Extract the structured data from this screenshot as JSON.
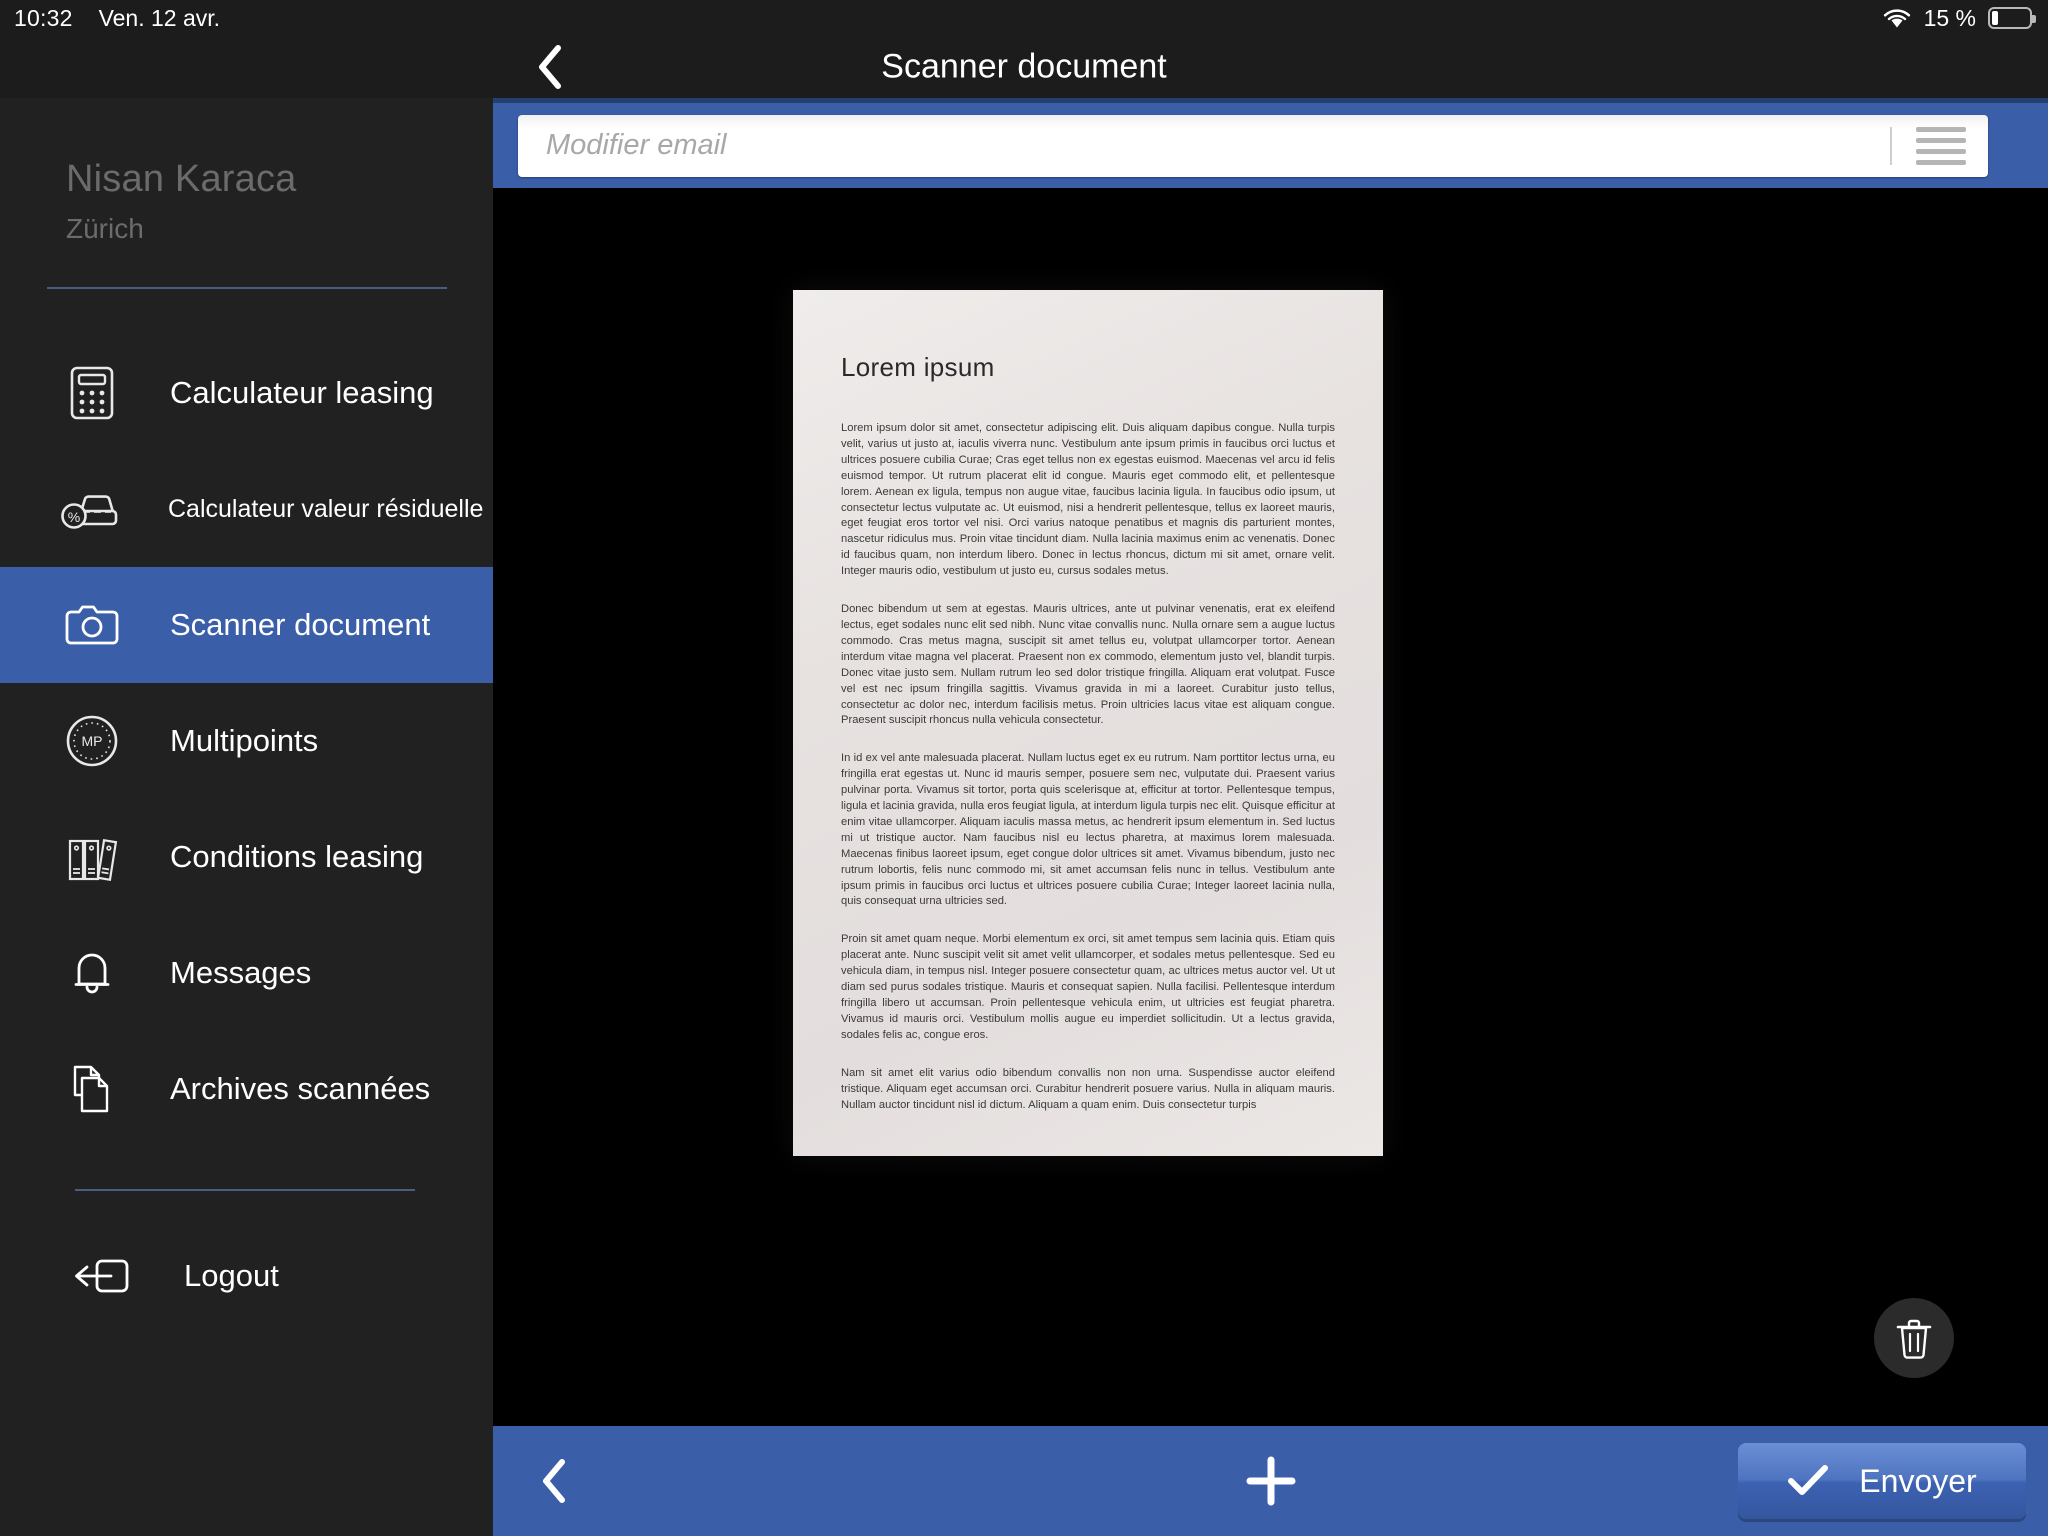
{
  "statusbar": {
    "time": "10:32",
    "date": "Ven. 12 avr.",
    "battery_percent": "15 %",
    "battery_level": 15,
    "wifi_icon": "wifi-icon",
    "battery_icon": "battery-icon"
  },
  "titlebar": {
    "back_icon": "chevron-left-icon",
    "title": "Scanner document"
  },
  "sidebar": {
    "user": {
      "name": "Nisan Karaca",
      "city": "Zürich"
    },
    "items": [
      {
        "label": "Calculateur leasing",
        "icon": "calculator-icon",
        "active": false,
        "small": false
      },
      {
        "label": "Calculateur valeur résiduelle",
        "icon": "car-percent-icon",
        "active": false,
        "small": true
      },
      {
        "label": "Scanner document",
        "icon": "camera-icon",
        "active": true,
        "small": false
      },
      {
        "label": "Multipoints",
        "icon": "multipoints-badge-icon",
        "active": false,
        "small": false
      },
      {
        "label": "Conditions leasing",
        "icon": "binders-icon",
        "active": false,
        "small": false
      },
      {
        "label": "Messages",
        "icon": "bell-icon",
        "active": false,
        "small": false
      },
      {
        "label": "Archives scannées",
        "icon": "documents-icon",
        "active": false,
        "small": false
      }
    ],
    "logout": {
      "label": "Logout",
      "icon": "logout-arrow-icon"
    }
  },
  "search": {
    "placeholder": "Modifier email",
    "value": "",
    "menu_icon": "hamburger-menu-icon"
  },
  "document": {
    "title": "Lorem ipsum",
    "paragraphs": [
      "Lorem ipsum dolor sit amet, consectetur adipiscing elit. Duis aliquam dapibus congue. Nulla turpis velit, varius ut justo at, iaculis viverra nunc. Vestibulum ante ipsum primis in faucibus orci luctus et ultrices posuere cubilia Curae; Cras eget tellus non ex egestas euismod. Maecenas vel arcu id felis euismod tempor. Ut rutrum placerat elit id congue. Mauris eget commodo elit, et pellentesque lorem. Aenean ex ligula, tempus non augue vitae, faucibus lacinia ligula. In faucibus odio ipsum, ut consectetur lectus vulputate ac. Ut euismod, nisi a hendrerit pellentesque, tellus ex laoreet mauris, eget feugiat eros tortor vel nisi. Orci varius natoque penatibus et magnis dis parturient montes, nascetur ridiculus mus. Proin vitae tincidunt diam. Nulla lacinia maximus enim ac venenatis. Donec id faucibus quam, non interdum libero. Donec in lectus rhoncus, dictum mi sit amet, ornare velit. Integer mauris odio, vestibulum ut justo eu, cursus sodales metus.",
      "Donec bibendum ut sem at egestas. Mauris ultrices, ante ut pulvinar venenatis, erat ex eleifend lectus, eget sodales nunc elit sed nibh. Nunc vitae convallis nunc. Nulla ornare sem a augue luctus commodo. Cras metus magna, suscipit sit amet tellus eu, volutpat ullamcorper tortor. Aenean interdum vitae magna vel placerat. Praesent non ex commodo, elementum justo vel, blandit turpis. Donec vitae justo sem. Nullam rutrum leo sed dolor tristique fringilla. Aliquam erat volutpat. Fusce vel est nec ipsum fringilla sagittis. Vivamus gravida in mi a laoreet. Curabitur justo tellus, consectetur ac dolor nec, interdum facilisis metus. Proin ultricies lacus vitae est aliquam congue. Praesent suscipit rhoncus nulla vehicula consectetur.",
      "In id ex vel ante malesuada placerat. Nullam luctus eget ex eu rutrum. Nam porttitor lectus urna, eu fringilla erat egestas ut. Nunc id mauris semper, posuere sem nec, vulputate dui. Praesent varius pulvinar porta. Vivamus sit tortor, porta quis scelerisque at, efficitur at tortor. Pellentesque tempus, ligula et lacinia gravida, nulla eros feugiat ligula, at interdum ligula turpis nec elit. Quisque efficitur at enim vitae ullamcorper. Aliquam iaculis massa metus, ac hendrerit ipsum elementum in. Sed luctus mi ut tristique auctor. Nam faucibus nisl eu lectus pharetra, at maximus lorem malesuada. Maecenas finibus laoreet ipsum, eget congue dolor ultrices sit amet. Vivamus bibendum, justo nec rutrum lobortis, felis nunc commodo mi, sit amet accumsan felis nunc in tellus. Vestibulum ante ipsum primis in faucibus orci luctus et ultrices posuere cubilia Curae; Integer laoreet lacinia nulla, quis consequat urna ultricies sed.",
      "Proin sit amet quam neque. Morbi elementum ex orci, sit amet tempus sem lacinia quis. Etiam quis placerat ante. Nunc suscipit velit sit amet velit ullamcorper, et sodales metus pellentesque. Sed eu vehicula diam, in tempus nisl. Integer posuere consectetur quam, ac ultrices metus auctor vel. Ut ut diam sed purus sodales tristique. Mauris et consequat sapien. Nulla facilisi. Pellentesque interdum fringilla libero ut accumsan. Proin pellentesque vehicula enim, ut ultricies est feugiat pharetra. Vivamus id mauris orci. Vestibulum mollis augue eu imperdiet sollicitudin. Ut a lectus gravida, sodales felis ac, congue eros.",
      "Nam sit amet elit varius odio bibendum convallis non non urna. Suspendisse auctor eleifend tristique. Aliquam eget accumsan orci. Curabitur hendrerit posuere varius. Nulla in aliquam mauris. Nullam auctor tincidunt nisl id dictum. Aliquam a quam enim. Duis consectetur turpis"
    ],
    "delete_icon": "trash-icon"
  },
  "bottombar": {
    "back_icon": "chevron-left-icon",
    "add_icon": "plus-icon",
    "send_label": "Envoyer",
    "send_check_icon": "check-icon"
  },
  "colors": {
    "accent_blue": "#3b5ea9",
    "sidebar_bg": "#212121",
    "statusbar_bg": "#1c1c1c",
    "page_bg": "#000000"
  }
}
